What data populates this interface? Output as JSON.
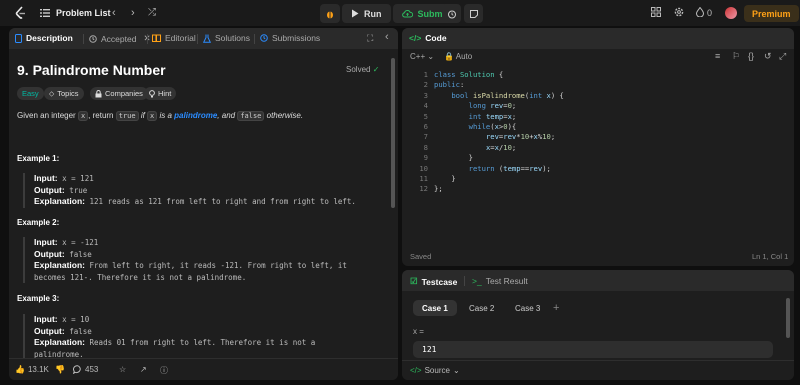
{
  "topbar": {
    "title": "Problem List",
    "prev": "‹",
    "next": "›",
    "shuffle": "⤮",
    "run_label": "Run",
    "submit_label": "Submit",
    "streak_count": "0",
    "premium_label": "Premium"
  },
  "left_tabs": {
    "description": "Description",
    "accepted": "Accepted",
    "editorial": "Editorial",
    "solutions": "Solutions",
    "submissions": "Submissions"
  },
  "problem": {
    "title": "9. Palindrome Number",
    "status": "Solved",
    "difficulty": "Easy",
    "topics": "Topics",
    "companies": "Companies",
    "hint": "Hint",
    "desc_pre": "Given an integer ",
    "desc_x": "x",
    "desc_mid": ", return ",
    "desc_true": "true",
    "desc_if": " if ",
    "desc_x2": "x",
    "desc_is_a": " is a ",
    "desc_pal": "palindrome",
    "desc_and": ", and ",
    "desc_false": "false",
    "desc_otherwise": " otherwise."
  },
  "examples": [
    {
      "title": "Example 1:",
      "input_label": "Input:",
      "input": "x = 121",
      "output_label": "Output:",
      "output": "true",
      "explanation_label": "Explanation:",
      "explanation": "121 reads as 121 from left to right and from right to left."
    },
    {
      "title": "Example 2:",
      "input_label": "Input:",
      "input": "x = -121",
      "output_label": "Output:",
      "output": "false",
      "explanation_label": "Explanation:",
      "explanation": "From left to right, it reads -121. From right to left, it",
      "explanation2": "becomes 121-. Therefore it is not a palindrome."
    },
    {
      "title": "Example 3:",
      "input_label": "Input:",
      "input": "x = 10",
      "output_label": "Output:",
      "output": "false",
      "explanation_label": "Explanation:",
      "explanation": "Reads 01 from right to left. Therefore it is not a",
      "explanation2": "palindrome."
    }
  ],
  "left_footer": {
    "likes": "13.1K",
    "comments": "453"
  },
  "code_panel": {
    "title": "Code",
    "language": "C++",
    "mode": "Auto",
    "saved": "Saved",
    "cursor": "Ln 1, Col 1",
    "line_numbers": [
      "1",
      "2",
      "3",
      "4",
      "5",
      "6",
      "7",
      "8",
      "9",
      "10",
      "11",
      "12"
    ]
  },
  "test_panel": {
    "testcase_tab": "Testcase",
    "result_tab": "Test Result",
    "cases": [
      "Case 1",
      "Case 2",
      "Case 3"
    ],
    "plus": "+",
    "var_label": "x =",
    "var_value": "121",
    "source": "Source"
  },
  "colors": {
    "accent_green": "#2cbb5d",
    "easy": "#00b8a3",
    "premium": "#ffa116",
    "link_blue": "#2b8cff"
  }
}
